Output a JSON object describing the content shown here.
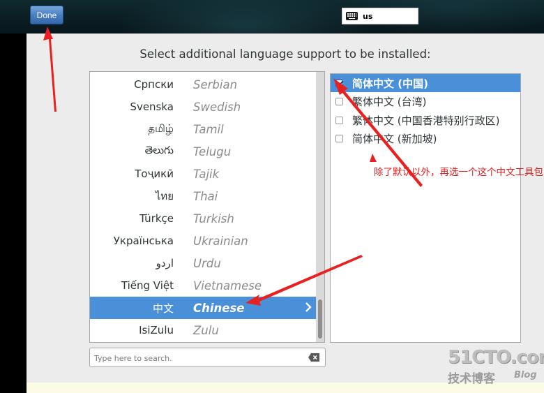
{
  "header": {
    "done_label": "Done",
    "keyboard_layout": "us"
  },
  "prompt": "Select additional language support to be installed:",
  "languages": [
    {
      "native": "Српски",
      "english": "Serbian"
    },
    {
      "native": "Svenska",
      "english": "Swedish"
    },
    {
      "native": "தமிழ்",
      "english": "Tamil"
    },
    {
      "native": "తెలుగు",
      "english": "Telugu"
    },
    {
      "native": "Тоҷикӣ",
      "english": "Tajik"
    },
    {
      "native": "ไทย",
      "english": "Thai"
    },
    {
      "native": "Türkçe",
      "english": "Turkish"
    },
    {
      "native": "Українська",
      "english": "Ukrainian"
    },
    {
      "native": "اردو",
      "english": "Urdu"
    },
    {
      "native": "Tiếng Việt",
      "english": "Vietnamese"
    },
    {
      "native": "中文",
      "english": "Chinese",
      "selected": true
    },
    {
      "native": "IsiZulu",
      "english": "Zulu"
    }
  ],
  "locales": [
    {
      "label": "简体中文 (中国)",
      "checked": true,
      "selected": true
    },
    {
      "label": "繁体中文 (台湾)",
      "checked": false
    },
    {
      "label": "繁体中文 (中国香港特别行政区)",
      "checked": false
    },
    {
      "label": "简体中文 (新加坡)",
      "checked": false
    }
  ],
  "search": {
    "placeholder": "Type here to search."
  },
  "annotation": {
    "text": "除了默认以外，再选一个这个中文工具包",
    "color": "#e02020"
  },
  "watermark": {
    "main": "51CTO.com",
    "sub": "技术博客",
    "blog": "Blog"
  },
  "colors": {
    "selection": "#4a90d9",
    "done_button": "#4a7fc0"
  },
  "icons": {
    "keyboard": "keyboard-icon",
    "chevron": "chevron-right-icon",
    "clear": "clear-search-icon"
  }
}
